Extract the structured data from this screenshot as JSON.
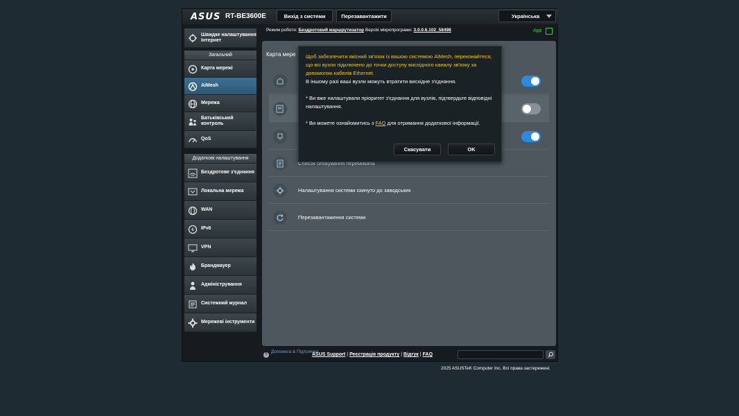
{
  "header": {
    "logo": "ASUS",
    "model": "RT-BE3600E",
    "logout_label": "Вихід з системи",
    "reboot_label": "Перезавантажити",
    "language": "Українська"
  },
  "status": {
    "mode_label": "Режим роботи:",
    "mode_value": "Бездротовий маршрутизатор",
    "fw_label": "Версія мікропрограми:",
    "fw_value": "3.0.0.6.102_58498",
    "app_label": "App"
  },
  "sidebar": {
    "quick_setup": "Швидке налаштування Інтернет",
    "general_header": "Загальний",
    "general": [
      {
        "label": "Карта мережі",
        "icon": "network-map-icon"
      },
      {
        "label": "AiMesh",
        "icon": "aimesh-icon"
      },
      {
        "label": "Мережа",
        "icon": "globe-icon"
      },
      {
        "label": "Батьківський контроль",
        "icon": "parental-icon"
      },
      {
        "label": "QoS",
        "icon": "gauge-icon"
      }
    ],
    "advanced_header": "Додаткові налаштування",
    "advanced": [
      {
        "label": "Бездротове з'єднання",
        "icon": "wireless-icon"
      },
      {
        "label": "Локальна мережа",
        "icon": "lan-icon"
      },
      {
        "label": "WAN",
        "icon": "wan-icon"
      },
      {
        "label": "IPv6",
        "icon": "ipv6-icon"
      },
      {
        "label": "VPN",
        "icon": "vpn-icon"
      },
      {
        "label": "Брандмауер",
        "icon": "firewall-icon"
      },
      {
        "label": "Адміністрування",
        "icon": "admin-icon"
      },
      {
        "label": "Системний журнал",
        "icon": "log-icon"
      },
      {
        "label": "Мережеві інструменти",
        "icon": "tools-icon"
      }
    ]
  },
  "main": {
    "title": "Карта мере",
    "rows": [
      {
        "label": "",
        "toggle": "on"
      },
      {
        "label": "",
        "toggle": "off"
      },
      {
        "label": "",
        "toggle": "on"
      },
      {
        "label": "Список блокування перемикача",
        "toggle": ""
      },
      {
        "label": "Налаштування системи скинуто до заводських",
        "toggle": ""
      },
      {
        "label": "Перезавантаження системи",
        "toggle": ""
      }
    ]
  },
  "dialog": {
    "warning": "Щоб забезпечити якісний зв'язок із вашою системою AiMesh, переконайтеся, що всі вузли підключено до точки доступу висхідного каналу зв'язку за допомогою кабелів Ethernet.",
    "line2": "В іншому разі ваші вузли можуть втратити висхідне з'єднання.",
    "line3": "* Ви вже налаштували пріоритет з'єднання для вузлів, підтвердьте відповідні налаштування.",
    "line4_pre": "* Ви можете ознайомитись з ",
    "line4_link": "FAQ",
    "line4_post": " для отримання додаткової інформації.",
    "cancel_label": "Скасувати",
    "ok_label": "OK"
  },
  "footer": {
    "help": "Допомога & Підтримка",
    "links": [
      "ASUS Support",
      "Реєстрація продукту",
      "Відгук",
      "FAQ"
    ],
    "copyright": "2025 ASUSTeK Computer Inc. Всі права застережені."
  }
}
